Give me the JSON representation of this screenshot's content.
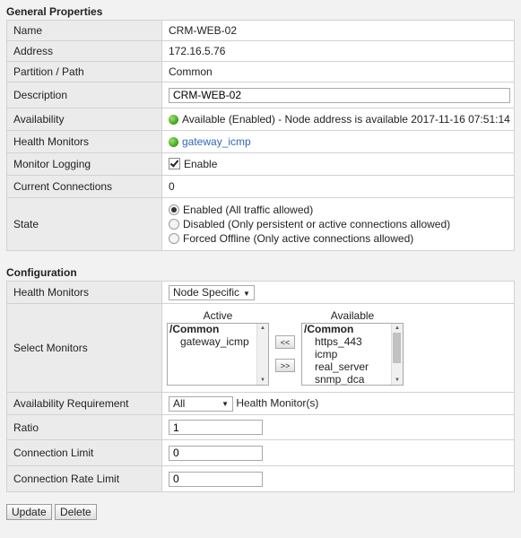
{
  "general": {
    "title": "General Properties",
    "name_label": "Name",
    "name_value": "CRM-WEB-02",
    "address_label": "Address",
    "address_value": "172.16.5.76",
    "partition_label": "Partition / Path",
    "partition_value": "Common",
    "description_label": "Description",
    "description_value": "CRM-WEB-02",
    "availability_label": "Availability",
    "availability_value": "Available (Enabled) - Node address is available 2017-11-16 07:51:14",
    "health_label": "Health Monitors",
    "health_value": "gateway_icmp",
    "logging_label": "Monitor Logging",
    "logging_value": "Enable",
    "connections_label": "Current Connections",
    "connections_value": "0",
    "state_label": "State",
    "state_options": [
      "Enabled (All traffic allowed)",
      "Disabled (Only persistent or active connections allowed)",
      "Forced Offline (Only active connections allowed)"
    ]
  },
  "config": {
    "title": "Configuration",
    "health_label": "Health Monitors",
    "health_select": "Node Specific",
    "select_label": "Select Monitors",
    "active_header": "Active",
    "available_header": "Available",
    "active_group": "/Common",
    "active_items": [
      "gateway_icmp"
    ],
    "available_group": "/Common",
    "available_items": [
      "https_443",
      "icmp",
      "real_server",
      "snmp_dca"
    ],
    "move_left": "<<",
    "move_right": ">>",
    "availability_label": "Availability Requirement",
    "availability_select": "All",
    "availability_suffix": "Health Monitor(s)",
    "ratio_label": "Ratio",
    "ratio_value": "1",
    "conn_limit_label": "Connection Limit",
    "conn_limit_value": "0",
    "rate_limit_label": "Connection Rate Limit",
    "rate_limit_value": "0"
  },
  "actions": {
    "update": "Update",
    "delete": "Delete"
  },
  "colors": {
    "accent_link": "#3366bb",
    "status_green": "#3aa01b"
  },
  "icons": {
    "status": "green-circle-icon",
    "check": "checkbox-checked-icon"
  }
}
